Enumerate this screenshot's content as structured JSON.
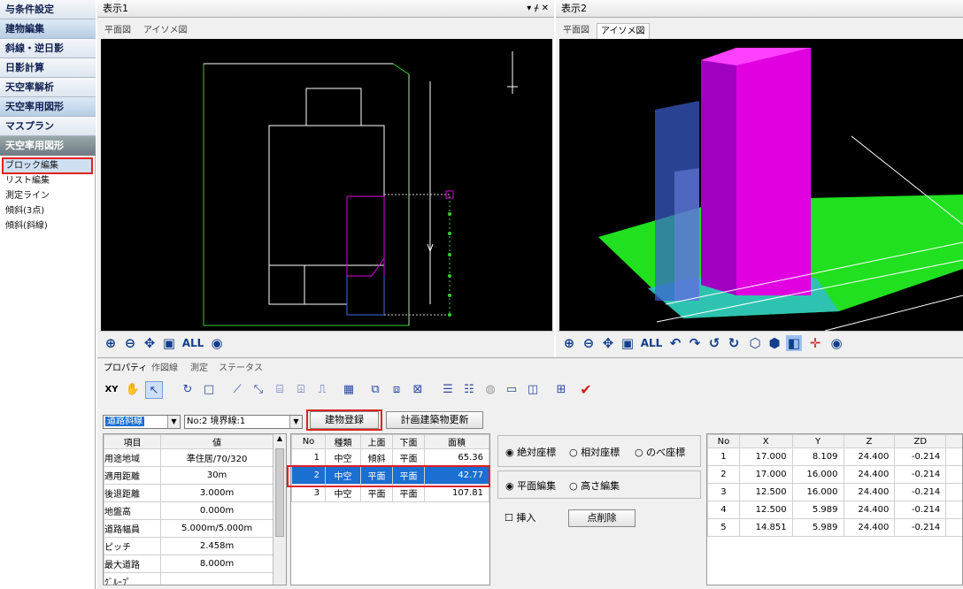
{
  "sidebar": {
    "items": [
      "与条件設定",
      "建物編集",
      "斜線・逆日影",
      "日影計算",
      "天空率解析",
      "天空率用図形",
      "マスプラン"
    ],
    "section_title": "天空率用図形",
    "sub_items": [
      "ブロック編集",
      "リスト編集",
      "測定ライン",
      "傾斜(3点)",
      "傾斜(斜線)"
    ]
  },
  "view1": {
    "title": "表示1",
    "controls": "▾ ᚋ ✕",
    "tabs": [
      "平面図",
      "アイソメ図"
    ],
    "active_tab": 0
  },
  "view2": {
    "title": "表示2",
    "tabs": [
      "平面図",
      "アイソメ図"
    ],
    "active_tab": 1
  },
  "zoom": {
    "all_label": "ALL"
  },
  "bottom": {
    "tabs": [
      "プロパティ",
      "作図線",
      "測定",
      "ステータス"
    ],
    "xyz_icon": "XY",
    "road_combo": "道路斜線",
    "boundary_combo": "No:2 境界線:1",
    "register_button": "建物登録",
    "update_button": "計画建築物更新"
  },
  "props": {
    "headers": [
      "項目",
      "値"
    ],
    "rows": [
      [
        "用途地域",
        "準住居/70/320"
      ],
      [
        "適用距離",
        "30m"
      ],
      [
        "後退距離",
        "3.000m"
      ],
      [
        "地盤高",
        "0.000m"
      ],
      [
        "道路幅員",
        "5.000m/5.000m"
      ],
      [
        "ピッチ",
        "2.458m"
      ],
      [
        "最大道路",
        "8.000m"
      ],
      [
        "ｸﾞﾙｰﾌﾟ",
        ""
      ]
    ]
  },
  "blocks": {
    "headers": [
      "No",
      "種類",
      "上面",
      "下面",
      "面積"
    ],
    "rows": [
      [
        "1",
        "中空",
        "傾斜",
        "平面",
        "65.36"
      ],
      [
        "2",
        "中空",
        "平面",
        "平面",
        "42.77"
      ],
      [
        "3",
        "中空",
        "平面",
        "平面",
        "107.81"
      ]
    ],
    "selected_row": 1
  },
  "coord_mode": {
    "options": [
      "絶対座標",
      "相対座標",
      "のべ座標"
    ],
    "selected": 0
  },
  "edit_mode": {
    "options": [
      "平面編集",
      "高さ編集"
    ],
    "selected": 0
  },
  "insert_label": "挿入",
  "delete_point_button": "点削除",
  "points": {
    "headers": [
      "No",
      "X",
      "Y",
      "Z",
      "ZD"
    ],
    "rows": [
      [
        "1",
        "17.000",
        "8.109",
        "24.400",
        "-0.214"
      ],
      [
        "2",
        "17.000",
        "16.000",
        "24.400",
        "-0.214"
      ],
      [
        "3",
        "12.500",
        "16.000",
        "24.400",
        "-0.214"
      ],
      [
        "4",
        "12.500",
        "5.989",
        "24.400",
        "-0.214"
      ],
      [
        "5",
        "14.851",
        "5.989",
        "24.400",
        "-0.214"
      ]
    ]
  },
  "colors": {
    "highlight": "#e02020",
    "selection": "#1a6fd0",
    "magenta": "#e000e0",
    "green": "#22e022",
    "blue": "#3a5fd0"
  }
}
